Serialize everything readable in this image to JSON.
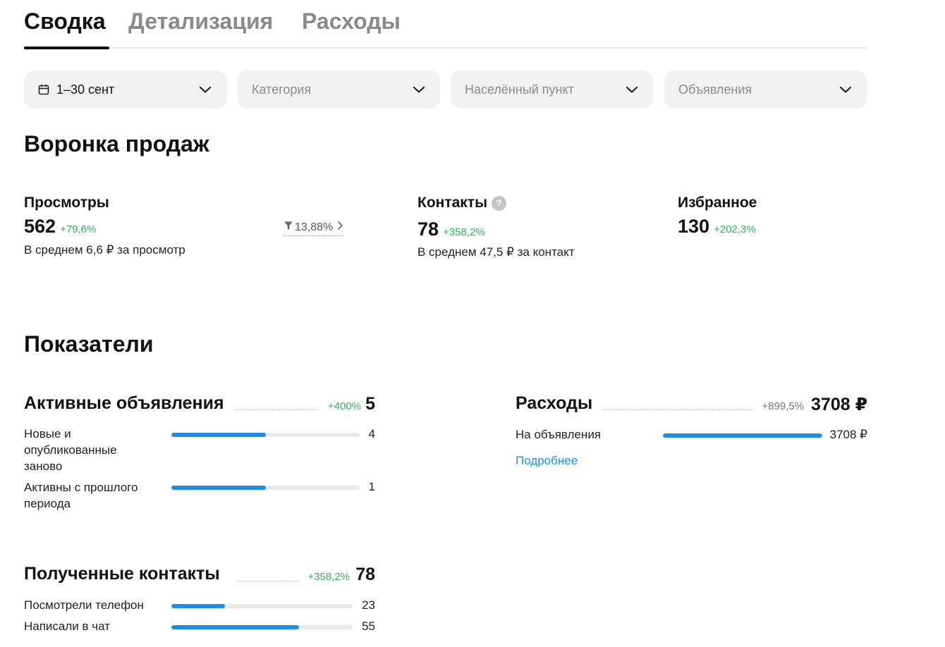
{
  "tabs": [
    {
      "label": "Сводка",
      "active": true
    },
    {
      "label": "Детализация",
      "active": false
    },
    {
      "label": "Расходы",
      "active": false
    }
  ],
  "filters": {
    "period": {
      "value": "1–30 сент",
      "icon": "calendar-icon"
    },
    "category": {
      "placeholder": "Категория"
    },
    "locality": {
      "placeholder": "Населённый пункт"
    },
    "ads": {
      "placeholder": "Объявления"
    }
  },
  "funnel": {
    "title": "Воронка продаж",
    "views": {
      "title": "Просмотры",
      "value": "562",
      "delta": "+79,6%",
      "sub": "В среднем 6,6 ₽ за просмотр"
    },
    "conversion": "13,88%",
    "contacts": {
      "title": "Контакты",
      "help": "?",
      "value": "78",
      "delta": "+358,2%",
      "sub": "В среднем 47,5 ₽ за контакт"
    },
    "favorites": {
      "title": "Избранное",
      "value": "130",
      "delta": "+202,3%"
    }
  },
  "indicators": {
    "title": "Показатели",
    "active_ads": {
      "title": "Активные объявления",
      "delta": "+400%",
      "value": "5",
      "rows": [
        {
          "label": "Новые и опубликованные заново",
          "value": "4",
          "fill": 0.5
        },
        {
          "label": "Активны с прошлого периода",
          "value": "1",
          "fill": 0.5
        }
      ]
    },
    "expenses": {
      "title": "Расходы",
      "delta": "+899,5%",
      "value": "3708 ₽",
      "rows": [
        {
          "label": "На объявления",
          "value": "3708 ₽",
          "fill": 1.0
        }
      ],
      "link": "Подробнее"
    },
    "contacts": {
      "title": "Полученные контакты",
      "delta": "+358,2%",
      "value": "78",
      "rows": [
        {
          "label": "Посмотрели телефон",
          "value": "23",
          "fill": 0.295
        },
        {
          "label": "Написали в чат",
          "value": "55",
          "fill": 0.705
        }
      ]
    }
  },
  "colors": {
    "accent": "#1f8de6",
    "positive": "#2eb35a",
    "track": "#e9e9e9"
  }
}
